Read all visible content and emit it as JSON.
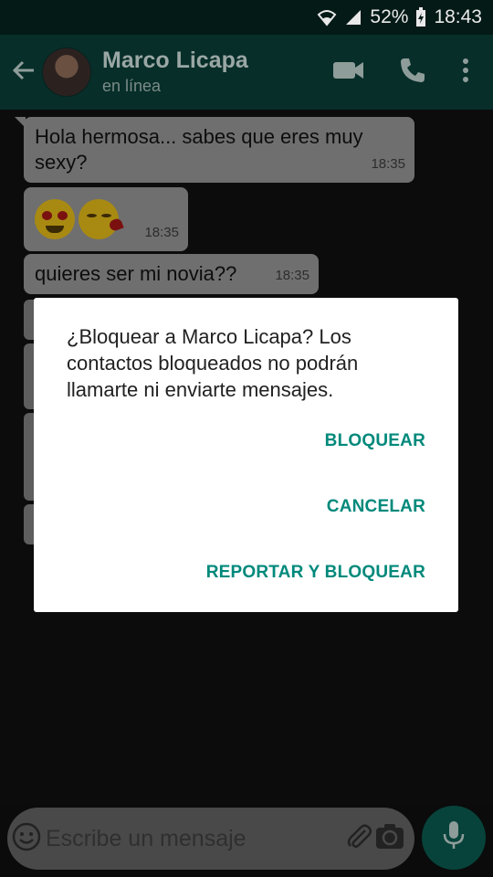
{
  "status_bar": {
    "battery": "52%",
    "time": "18:43"
  },
  "header": {
    "contact_name": "Marco Licapa",
    "contact_status": "en línea"
  },
  "messages": [
    {
      "text": "Hola hermosa... sabes que eres muy sexy?",
      "time": "18:35"
    },
    {
      "text": "",
      "time": "18:35",
      "emojis": [
        "heart-eyes-emoji",
        "kissing-face-emoji"
      ]
    },
    {
      "text": "quieres ser mi novia??",
      "time": "18:35"
    }
  ],
  "input": {
    "placeholder": "Escribe un mensaje"
  },
  "dialog": {
    "message": "¿Bloquear a Marco Licapa? Los contactos bloqueados no podrán llamarte ni enviarte mensajes.",
    "buttons": {
      "block": "BLOQUEAR",
      "cancel": "CANCELAR",
      "report_block": "REPORTAR Y BLOQUEAR"
    }
  },
  "colors": {
    "header": "#072e29",
    "accent": "#00897b",
    "dialog_bg": "#ffffff",
    "bubble": "#6f6f6f"
  },
  "icons": [
    "wifi-icon",
    "signal-icon",
    "battery-icon",
    "back-arrow-icon",
    "video-call-icon",
    "phone-icon",
    "more-vert-icon",
    "emoji-icon",
    "attach-icon",
    "camera-icon",
    "mic-icon"
  ]
}
